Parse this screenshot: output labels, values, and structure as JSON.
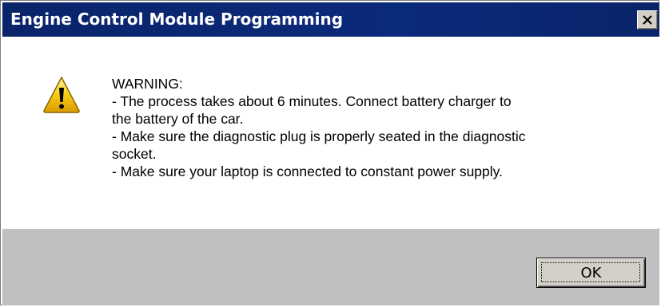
{
  "window": {
    "title": "Engine Control Module Programming",
    "close_glyph": "×"
  },
  "message": {
    "icon": "warning-icon",
    "lines": [
      "WARNING:",
      "- The process takes about 6 minutes. Connect battery charger to",
      "the battery of the car.",
      "- Make sure the diagnostic plug is properly seated in the diagnostic",
      "socket.",
      "- Make sure your laptop is connected to constant power supply."
    ]
  },
  "buttons": {
    "ok_label": "OK"
  },
  "colors": {
    "titlebar": "#0a246a",
    "footer": "#c0c0c0",
    "warning_yellow": "#f5c400"
  }
}
